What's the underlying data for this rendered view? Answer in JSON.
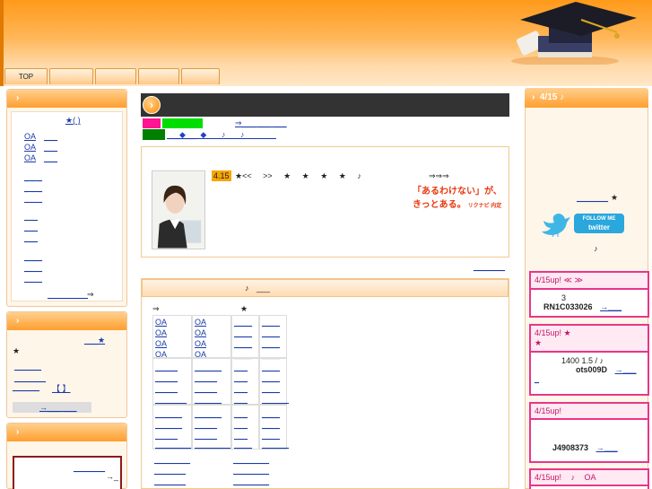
{
  "header": {
    "nav": [
      "TOP",
      "",
      "",
      "",
      ""
    ]
  },
  "left": {
    "box1": {
      "head_icon": "›",
      "star_link": "★( )",
      "oa_links": [
        "OA",
        "OA",
        "OA"
      ],
      "dash_rows": [
        "_ _ _",
        "_ _ _",
        "_ _ _"
      ],
      "footer_arrow": "⇒"
    },
    "box2": {
      "head_icon": "›",
      "star_line": "___★",
      "star2": "★",
      "bracket_link": "【 】",
      "arrow_link": "→___ ___"
    },
    "box3": {
      "head_icon": "›",
      "arrow": "→_"
    }
  },
  "main": {
    "arrow_links": "⇒___ ___ ___",
    "diamond_row": "◆ ◆ ♪ ♪",
    "feature": {
      "date_badge": "4.15",
      "text": "★<< >> ★ ★ ★ ★ ♪",
      "arrows": "⇒⇒⇒",
      "banner_line1": "「あるわけない」が、",
      "banner_line2": "きっとある。",
      "banner_brand": "リクナビ 内定"
    },
    "category": {
      "title": "♪ ___",
      "arrow": "⇒",
      "star": "★",
      "oa_cells": [
        "OA",
        "OA",
        "OA",
        "OA",
        "OA",
        "OA",
        "OA",
        "OA"
      ]
    }
  },
  "right": {
    "head": "4/15 ♪",
    "twitter_star": "★",
    "twitter_label_top": "FOLLOW ME",
    "twitter_label_bottom": "twitter",
    "note": "♪",
    "news": [
      {
        "head": "4/15up! ≪ ≫",
        "line1": "3",
        "code": "RN1C033026",
        "arrow": "→___"
      },
      {
        "head": "4/15up! ★",
        "line0": "★",
        "line1": "1400 1.5 / ♪",
        "code": "ots009D",
        "arrow": "→___"
      },
      {
        "head": "4/15up!",
        "code": "J4908373",
        "arrow": "→___"
      },
      {
        "head": "4/15up! ♪ OA"
      }
    ]
  },
  "colors": {
    "accent": "#ff9a1a",
    "news_border": "#e8368a",
    "green": "#00dd00",
    "magenta": "#ff1493",
    "dark_green": "#008000"
  }
}
